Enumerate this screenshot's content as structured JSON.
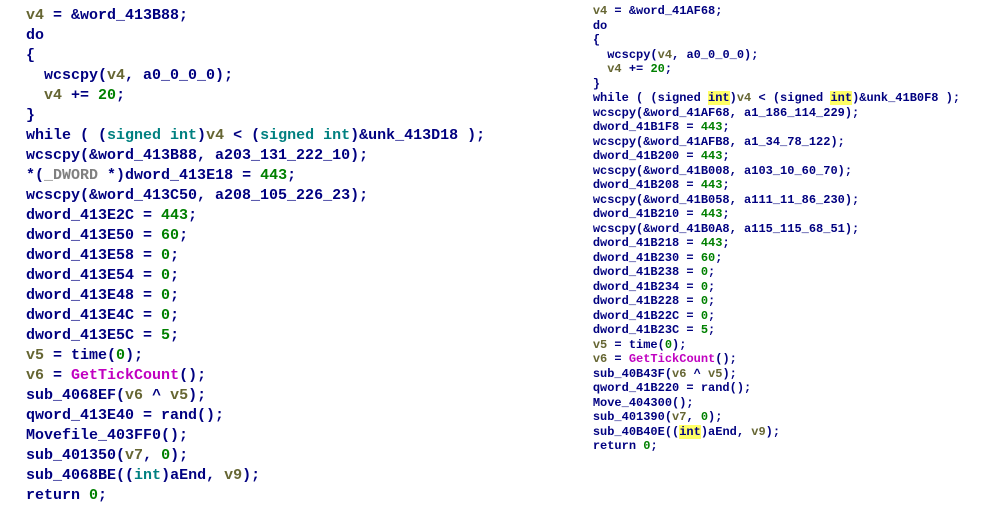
{
  "left": {
    "lines": [
      {
        "indent": 1,
        "tokens": [
          {
            "c": "var",
            "t": "v4"
          },
          {
            "c": "kw",
            "t": " = &word_413B88;"
          }
        ]
      },
      {
        "indent": 1,
        "tokens": [
          {
            "c": "kw",
            "t": "do"
          }
        ]
      },
      {
        "indent": 1,
        "tokens": [
          {
            "c": "kw",
            "t": "{"
          }
        ]
      },
      {
        "indent": 2,
        "tokens": [
          {
            "c": "kw",
            "t": "wcscpy("
          },
          {
            "c": "var",
            "t": "v4"
          },
          {
            "c": "kw",
            "t": ", a0_0_0_0);"
          }
        ]
      },
      {
        "indent": 2,
        "tokens": [
          {
            "c": "var",
            "t": "v4"
          },
          {
            "c": "kw",
            "t": " += "
          },
          {
            "c": "lit",
            "t": "20"
          },
          {
            "c": "kw",
            "t": ";"
          }
        ]
      },
      {
        "indent": 1,
        "tokens": [
          {
            "c": "kw",
            "t": "}"
          }
        ]
      },
      {
        "indent": 1,
        "tokens": [
          {
            "c": "kw",
            "t": "while ( ("
          },
          {
            "c": "fmt",
            "t": "signed int"
          },
          {
            "c": "kw",
            "t": ")"
          },
          {
            "c": "var",
            "t": "v4"
          },
          {
            "c": "kw",
            "t": " < ("
          },
          {
            "c": "fmt",
            "t": "signed int"
          },
          {
            "c": "kw",
            "t": ")&unk_413D18 );"
          }
        ]
      },
      {
        "indent": 1,
        "tokens": [
          {
            "c": "kw",
            "t": "wcscpy(&word_413B88, a203_131_222_10);"
          }
        ]
      },
      {
        "indent": 1,
        "tokens": [
          {
            "c": "kw",
            "t": "*("
          },
          {
            "c": "gray",
            "t": "_DWORD "
          },
          {
            "c": "kw",
            "t": "*)dword_413E18 = "
          },
          {
            "c": "lit",
            "t": "443"
          },
          {
            "c": "kw",
            "t": ";"
          }
        ]
      },
      {
        "indent": 1,
        "tokens": [
          {
            "c": "kw",
            "t": "wcscpy(&word_413C50, a208_105_226_23);"
          }
        ]
      },
      {
        "indent": 1,
        "tokens": [
          {
            "c": "kw",
            "t": "dword_413E2C = "
          },
          {
            "c": "lit",
            "t": "443"
          },
          {
            "c": "kw",
            "t": ";"
          }
        ]
      },
      {
        "indent": 1,
        "tokens": [
          {
            "c": "kw",
            "t": "dword_413E50 = "
          },
          {
            "c": "lit",
            "t": "60"
          },
          {
            "c": "kw",
            "t": ";"
          }
        ]
      },
      {
        "indent": 1,
        "tokens": [
          {
            "c": "kw",
            "t": "dword_413E58 = "
          },
          {
            "c": "lit",
            "t": "0"
          },
          {
            "c": "kw",
            "t": ";"
          }
        ]
      },
      {
        "indent": 1,
        "tokens": [
          {
            "c": "kw",
            "t": "dword_413E54 = "
          },
          {
            "c": "lit",
            "t": "0"
          },
          {
            "c": "kw",
            "t": ";"
          }
        ]
      },
      {
        "indent": 1,
        "tokens": [
          {
            "c": "kw",
            "t": "dword_413E48 = "
          },
          {
            "c": "lit",
            "t": "0"
          },
          {
            "c": "kw",
            "t": ";"
          }
        ]
      },
      {
        "indent": 1,
        "tokens": [
          {
            "c": "kw",
            "t": "dword_413E4C = "
          },
          {
            "c": "lit",
            "t": "0"
          },
          {
            "c": "kw",
            "t": ";"
          }
        ]
      },
      {
        "indent": 1,
        "tokens": [
          {
            "c": "kw",
            "t": "dword_413E5C = "
          },
          {
            "c": "lit",
            "t": "5"
          },
          {
            "c": "kw",
            "t": ";"
          }
        ]
      },
      {
        "indent": 1,
        "tokens": [
          {
            "c": "var",
            "t": "v5"
          },
          {
            "c": "kw",
            "t": " = time("
          },
          {
            "c": "lit",
            "t": "0"
          },
          {
            "c": "kw",
            "t": ");"
          }
        ]
      },
      {
        "indent": 1,
        "tokens": [
          {
            "c": "var",
            "t": "v6"
          },
          {
            "c": "kw",
            "t": " = "
          },
          {
            "c": "api",
            "t": "GetTickCount"
          },
          {
            "c": "kw",
            "t": "();"
          }
        ]
      },
      {
        "indent": 1,
        "tokens": [
          {
            "c": "kw",
            "t": "sub_4068EF("
          },
          {
            "c": "var",
            "t": "v6"
          },
          {
            "c": "kw",
            "t": " ^ "
          },
          {
            "c": "var",
            "t": "v5"
          },
          {
            "c": "kw",
            "t": ");"
          }
        ]
      },
      {
        "indent": 1,
        "tokens": [
          {
            "c": "kw",
            "t": "qword_413E40 = rand();"
          }
        ]
      },
      {
        "indent": 1,
        "tokens": [
          {
            "c": "kw",
            "t": "Movefile_403FF0();"
          }
        ]
      },
      {
        "indent": 1,
        "tokens": [
          {
            "c": "kw",
            "t": "sub_401350("
          },
          {
            "c": "var",
            "t": "v7"
          },
          {
            "c": "kw",
            "t": ", "
          },
          {
            "c": "lit",
            "t": "0"
          },
          {
            "c": "kw",
            "t": ");"
          }
        ]
      },
      {
        "indent": 1,
        "tokens": [
          {
            "c": "kw",
            "t": "sub_4068BE(("
          },
          {
            "c": "fmt",
            "t": "int"
          },
          {
            "c": "kw",
            "t": ")aEnd, "
          },
          {
            "c": "var",
            "t": "v9"
          },
          {
            "c": "kw",
            "t": ");"
          }
        ]
      },
      {
        "indent": 1,
        "tokens": [
          {
            "c": "kw",
            "t": "return "
          },
          {
            "c": "lit",
            "t": "0"
          },
          {
            "c": "kw",
            "t": ";"
          }
        ]
      }
    ]
  },
  "right": {
    "lines": [
      {
        "indent": 2,
        "tokens": [
          {
            "c": "var",
            "t": "v4"
          },
          {
            "c": "kw",
            "t": " = &word_41AF68;"
          }
        ]
      },
      {
        "indent": 2,
        "tokens": [
          {
            "c": "kw",
            "t": "do"
          }
        ]
      },
      {
        "indent": 2,
        "tokens": [
          {
            "c": "kw",
            "t": "{"
          }
        ]
      },
      {
        "indent": 3,
        "tokens": [
          {
            "c": "kw",
            "t": "wcscpy("
          },
          {
            "c": "var",
            "t": "v4"
          },
          {
            "c": "kw",
            "t": ", a0_0_0_0);"
          }
        ]
      },
      {
        "indent": 3,
        "tokens": [
          {
            "c": "var",
            "t": "v4"
          },
          {
            "c": "kw",
            "t": " += "
          },
          {
            "c": "lit",
            "t": "20"
          },
          {
            "c": "kw",
            "t": ";"
          }
        ]
      },
      {
        "indent": 2,
        "tokens": [
          {
            "c": "kw",
            "t": "}"
          }
        ]
      },
      {
        "indent": 2,
        "tokens": [
          {
            "c": "kw",
            "t": "while ( (signed "
          },
          {
            "c": "hl",
            "t": "int"
          },
          {
            "c": "kw",
            "t": ")"
          },
          {
            "c": "var",
            "t": "v4"
          },
          {
            "c": "kw",
            "t": " < (signed "
          },
          {
            "c": "hl",
            "t": "int"
          },
          {
            "c": "kw",
            "t": ")&unk_41B0F8 );"
          }
        ]
      },
      {
        "indent": 2,
        "tokens": [
          {
            "c": "kw",
            "t": "wcscpy(&word_41AF68, a1_186_114_229);"
          }
        ]
      },
      {
        "indent": 2,
        "tokens": [
          {
            "c": "kw",
            "t": "dword_41B1F8 = "
          },
          {
            "c": "lit",
            "t": "443"
          },
          {
            "c": "kw",
            "t": ";"
          }
        ]
      },
      {
        "indent": 2,
        "tokens": [
          {
            "c": "kw",
            "t": "wcscpy(&word_41AFB8, a1_34_78_122);"
          }
        ]
      },
      {
        "indent": 2,
        "tokens": [
          {
            "c": "kw",
            "t": "dword_41B200 = "
          },
          {
            "c": "lit",
            "t": "443"
          },
          {
            "c": "kw",
            "t": ";"
          }
        ]
      },
      {
        "indent": 2,
        "tokens": [
          {
            "c": "kw",
            "t": "wcscpy(&word_41B008, a103_10_60_70);"
          }
        ]
      },
      {
        "indent": 2,
        "tokens": [
          {
            "c": "kw",
            "t": "dword_41B208 = "
          },
          {
            "c": "lit",
            "t": "443"
          },
          {
            "c": "kw",
            "t": ";"
          }
        ]
      },
      {
        "indent": 2,
        "tokens": [
          {
            "c": "kw",
            "t": "wcscpy(&word_41B058, a111_11_86_230);"
          }
        ]
      },
      {
        "indent": 2,
        "tokens": [
          {
            "c": "kw",
            "t": "dword_41B210 = "
          },
          {
            "c": "lit",
            "t": "443"
          },
          {
            "c": "kw",
            "t": ";"
          }
        ]
      },
      {
        "indent": 2,
        "tokens": [
          {
            "c": "kw",
            "t": "wcscpy(&word_41B0A8, a115_115_68_51);"
          }
        ]
      },
      {
        "indent": 2,
        "tokens": [
          {
            "c": "kw",
            "t": "dword_41B218 = "
          },
          {
            "c": "lit",
            "t": "443"
          },
          {
            "c": "kw",
            "t": ";"
          }
        ]
      },
      {
        "indent": 2,
        "tokens": [
          {
            "c": "kw",
            "t": "dword_41B230 = "
          },
          {
            "c": "lit",
            "t": "60"
          },
          {
            "c": "kw",
            "t": ";"
          }
        ]
      },
      {
        "indent": 2,
        "tokens": [
          {
            "c": "kw",
            "t": "dword_41B238 = "
          },
          {
            "c": "lit",
            "t": "0"
          },
          {
            "c": "kw",
            "t": ";"
          }
        ]
      },
      {
        "indent": 2,
        "tokens": [
          {
            "c": "kw",
            "t": "dword_41B234 = "
          },
          {
            "c": "lit",
            "t": "0"
          },
          {
            "c": "kw",
            "t": ";"
          }
        ]
      },
      {
        "indent": 2,
        "tokens": [
          {
            "c": "kw",
            "t": "dword_41B228 = "
          },
          {
            "c": "lit",
            "t": "0"
          },
          {
            "c": "kw",
            "t": ";"
          }
        ]
      },
      {
        "indent": 2,
        "tokens": [
          {
            "c": "kw",
            "t": "dword_41B22C = "
          },
          {
            "c": "lit",
            "t": "0"
          },
          {
            "c": "kw",
            "t": ";"
          }
        ]
      },
      {
        "indent": 2,
        "tokens": [
          {
            "c": "kw",
            "t": "dword_41B23C = "
          },
          {
            "c": "lit",
            "t": "5"
          },
          {
            "c": "kw",
            "t": ";"
          }
        ]
      },
      {
        "indent": 2,
        "tokens": [
          {
            "c": "var",
            "t": "v5"
          },
          {
            "c": "kw",
            "t": " = time("
          },
          {
            "c": "lit",
            "t": "0"
          },
          {
            "c": "kw",
            "t": ");"
          }
        ]
      },
      {
        "indent": 2,
        "tokens": [
          {
            "c": "var",
            "t": "v6"
          },
          {
            "c": "kw",
            "t": " = "
          },
          {
            "c": "api",
            "t": "GetTickCount"
          },
          {
            "c": "kw",
            "t": "();"
          }
        ]
      },
      {
        "indent": 2,
        "tokens": [
          {
            "c": "kw",
            "t": "sub_40B43F("
          },
          {
            "c": "var",
            "t": "v6"
          },
          {
            "c": "kw",
            "t": " ^ "
          },
          {
            "c": "var",
            "t": "v5"
          },
          {
            "c": "kw",
            "t": ");"
          }
        ]
      },
      {
        "indent": 2,
        "tokens": [
          {
            "c": "kw",
            "t": "qword_41B220 = rand();"
          }
        ]
      },
      {
        "indent": 2,
        "tokens": [
          {
            "c": "kw",
            "t": "Move_404300();"
          }
        ]
      },
      {
        "indent": 2,
        "tokens": [
          {
            "c": "kw",
            "t": "sub_401390("
          },
          {
            "c": "var",
            "t": "v7"
          },
          {
            "c": "kw",
            "t": ", "
          },
          {
            "c": "lit",
            "t": "0"
          },
          {
            "c": "kw",
            "t": ");"
          }
        ]
      },
      {
        "indent": 2,
        "tokens": [
          {
            "c": "kw",
            "t": "sub_40B40E(("
          },
          {
            "c": "hl",
            "t": "int"
          },
          {
            "c": "kw",
            "t": ")aEnd, "
          },
          {
            "c": "var",
            "t": "v9"
          },
          {
            "c": "kw",
            "t": ");"
          }
        ]
      },
      {
        "indent": 2,
        "tokens": [
          {
            "c": "kw",
            "t": "return "
          },
          {
            "c": "lit",
            "t": "0"
          },
          {
            "c": "kw",
            "t": ";"
          }
        ]
      }
    ]
  }
}
